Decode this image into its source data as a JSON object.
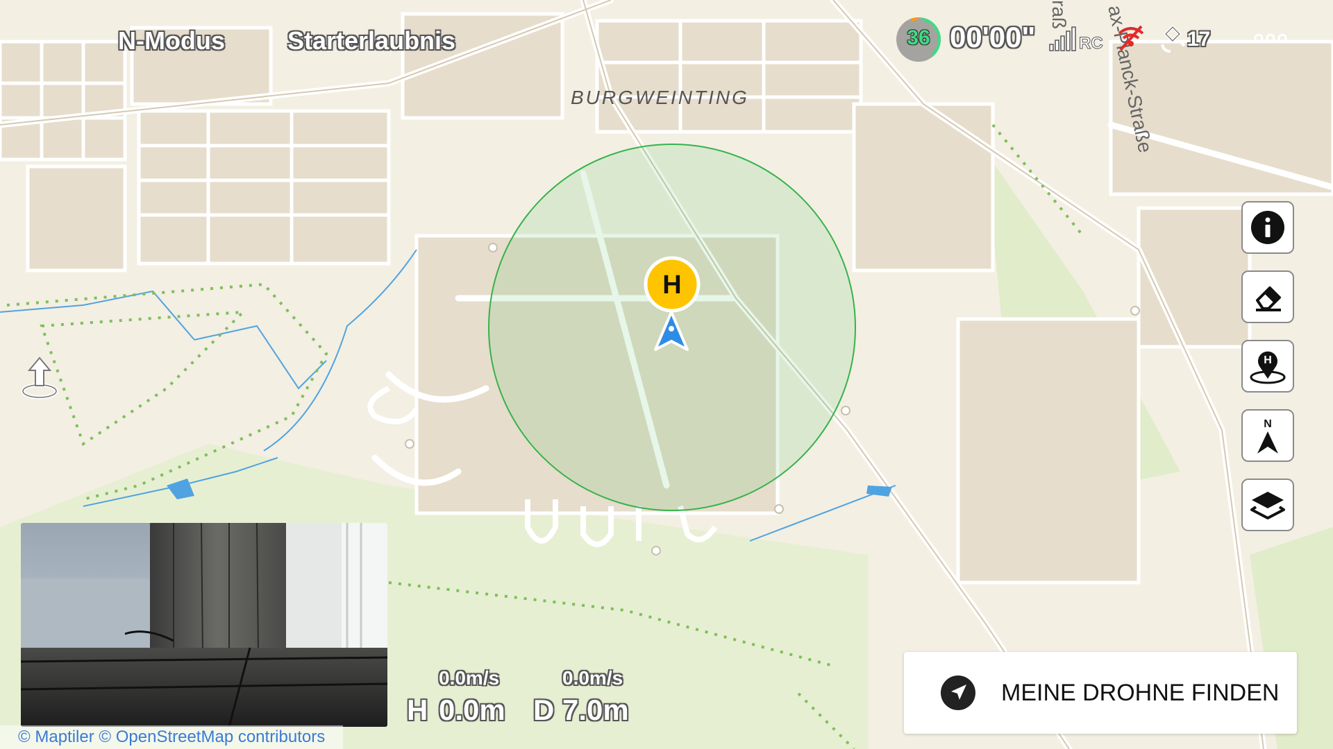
{
  "header": {
    "mode": "N-Modus",
    "permit": "Starterlaubnis",
    "battery": "36",
    "timer": "00'00\"",
    "signal_label": "RC",
    "satellites": "17",
    "back_icon": "back-arrow-icon",
    "more_icon": "more-dots-icon"
  },
  "map": {
    "place_label": "BURGWEINTING",
    "street_label_1": "ax-Planck-Straße",
    "street_label_2": "raß",
    "home_marker": "H",
    "credits": "© Maptiler © OpenStreetMap contributors",
    "colors": {
      "land": "#f3efe3",
      "block": "#e6ddcc",
      "road": "#ffffff",
      "green": "#dcebc4",
      "geofence": "#34b34a",
      "water": "#4fa3e0",
      "home": "#ffc400",
      "drone": "#2f8ce6"
    }
  },
  "tools": {
    "info_icon": "info-icon",
    "eraser_icon": "eraser-icon",
    "home_point_icon": "home-point-icon",
    "home_point_letter": "H",
    "north_icon": "north-compass-icon",
    "north_letter": "N",
    "layers_icon": "layers-icon",
    "takeoff_icon": "takeoff-icon"
  },
  "find_drone": {
    "label": "MEINE DROHNE FINDEN",
    "icon": "locate-drone-icon"
  },
  "telemetry": {
    "v_speed": "0.0m/s",
    "h_speed": "0.0m/s",
    "h_label": "H",
    "h_value": "0.0m",
    "d_label": "D",
    "d_value": "7.0m"
  }
}
